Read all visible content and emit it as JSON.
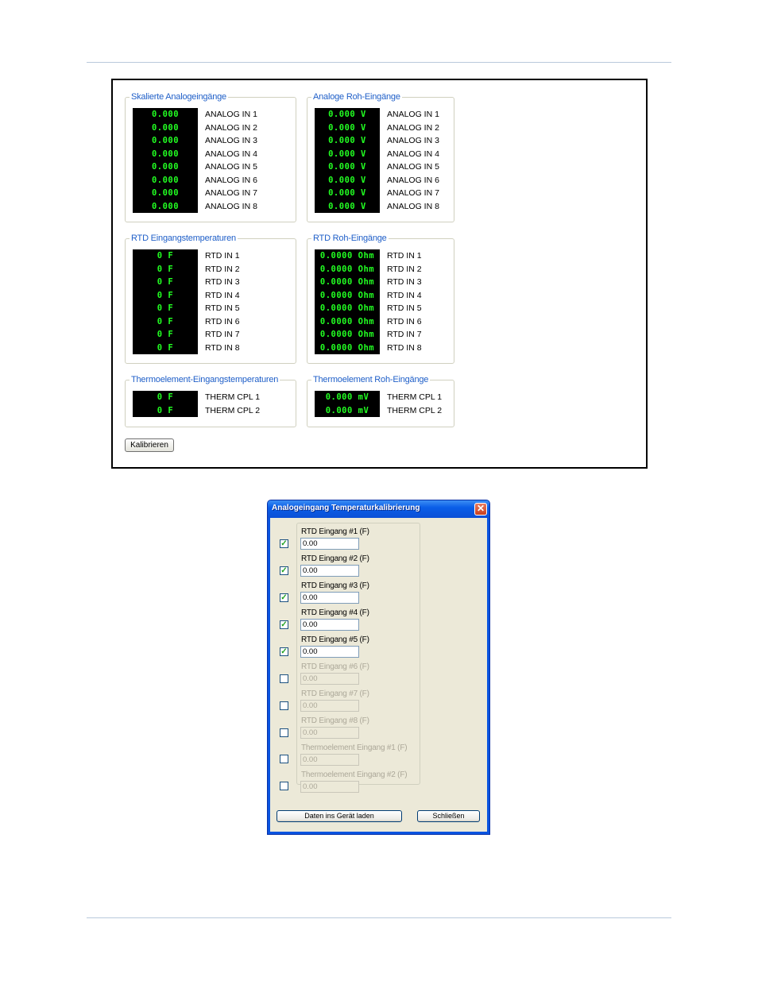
{
  "panel": {
    "groups": [
      {
        "title": "Skalierte Analogeingänge",
        "values": [
          "0.000",
          "0.000",
          "0.000",
          "0.000",
          "0.000",
          "0.000",
          "0.000",
          "0.000"
        ],
        "labels": [
          "ANALOG IN 1",
          "ANALOG IN 2",
          "ANALOG IN 3",
          "ANALOG IN 4",
          "ANALOG IN 5",
          "ANALOG IN 6",
          "ANALOG IN 7",
          "ANALOG IN 8"
        ]
      },
      {
        "title": "Analoge Roh-Eingänge",
        "values": [
          "0.000 V",
          "0.000 V",
          "0.000 V",
          "0.000 V",
          "0.000 V",
          "0.000 V",
          "0.000 V",
          "0.000 V"
        ],
        "labels": [
          "ANALOG IN 1",
          "ANALOG IN 2",
          "ANALOG IN 3",
          "ANALOG IN 4",
          "ANALOG IN 5",
          "ANALOG IN 6",
          "ANALOG IN 7",
          "ANALOG IN 8"
        ]
      },
      {
        "title": "RTD Eingangstemperaturen",
        "values": [
          "0 F",
          "0 F",
          "0 F",
          "0 F",
          "0 F",
          "0 F",
          "0 F",
          "0 F"
        ],
        "labels": [
          "RTD IN 1",
          "RTD IN 2",
          "RTD IN 3",
          "RTD IN 4",
          "RTD IN 5",
          "RTD IN 6",
          "RTD IN 7",
          "RTD IN 8"
        ]
      },
      {
        "title": "RTD Roh-Eingänge",
        "values": [
          "0.0000 Ohm",
          "0.0000 Ohm",
          "0.0000 Ohm",
          "0.0000 Ohm",
          "0.0000 Ohm",
          "0.0000 Ohm",
          "0.0000 Ohm",
          "0.0000 Ohm"
        ],
        "labels": [
          "RTD IN 1",
          "RTD IN 2",
          "RTD IN 3",
          "RTD IN 4",
          "RTD IN 5",
          "RTD IN 6",
          "RTD IN 7",
          "RTD IN 8"
        ]
      },
      {
        "title": "Thermoelement-Eingangstemperaturen",
        "values": [
          "0 F",
          "0 F"
        ],
        "labels": [
          "THERM CPL 1",
          "THERM CPL 2"
        ]
      },
      {
        "title": "Thermoelement Roh-Eingänge",
        "values": [
          "0.000 mV",
          "0.000 mV"
        ],
        "labels": [
          "THERM CPL 1",
          "THERM CPL 2"
        ]
      }
    ],
    "calibrate_label": "Kalibrieren"
  },
  "dialog": {
    "title": "Analogeingang Temperaturkalibrierung",
    "close_glyph": "✕",
    "check_glyph": "✓",
    "fields": [
      {
        "label": "RTD Eingang #1 (F)",
        "value": "0.00",
        "checked": true
      },
      {
        "label": "RTD Eingang #2 (F)",
        "value": "0.00",
        "checked": true
      },
      {
        "label": "RTD Eingang #3 (F)",
        "value": "0.00",
        "checked": true
      },
      {
        "label": "RTD Eingang #4 (F)",
        "value": "0.00",
        "checked": true
      },
      {
        "label": "RTD Eingang #5 (F)",
        "value": "0.00",
        "checked": true
      },
      {
        "label": "RTD Eingang #6 (F)",
        "value": "0.00",
        "checked": false
      },
      {
        "label": "RTD Eingang #7 (F)",
        "value": "0.00",
        "checked": false
      },
      {
        "label": "RTD Eingang #8 (F)",
        "value": "0.00",
        "checked": false
      },
      {
        "label": "Thermoelement Eingang #1 (F)",
        "value": "0.00",
        "checked": false
      },
      {
        "label": "Thermoelement Eingang #2 (F)",
        "value": "0.00",
        "checked": false
      }
    ],
    "load_label": "Daten ins Gerät laden",
    "close_label": "Schließen"
  },
  "colors": {
    "lcd_background": "#000000",
    "lcd_text": "#22ff22",
    "group_title": "#1f5fc8",
    "dialog_titlebar": "#0a5ee8",
    "dialog_face": "#ece9d8"
  }
}
